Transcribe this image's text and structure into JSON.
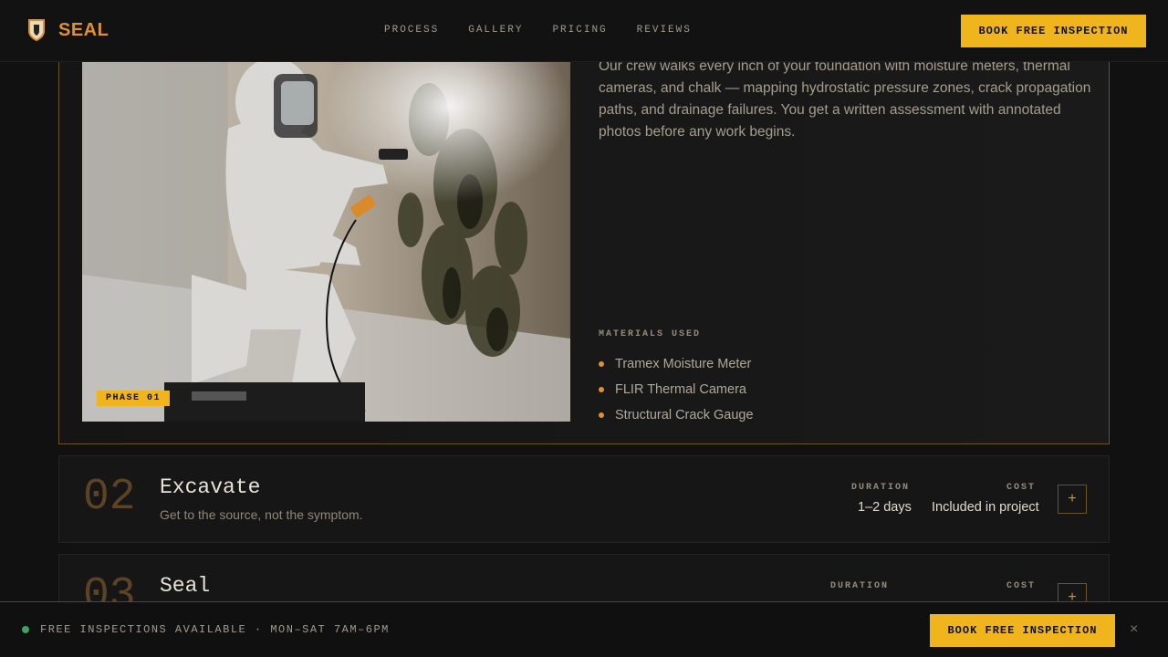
{
  "brand": {
    "name": "SEAL"
  },
  "nav": {
    "items": [
      "PROCESS",
      "GALLERY",
      "PRICING",
      "REVIEWS"
    ]
  },
  "header": {
    "cta_label": "BOOK FREE INSPECTION"
  },
  "phase1": {
    "badge": "PHASE 01",
    "description": "Our crew walks every inch of your foundation with moisture meters, thermal cameras, and chalk — mapping hydrostatic pressure zones, crack propagation paths, and drainage failures. You get a written assessment with annotated photos before any work begins.",
    "materials_title": "MATERIALS USED",
    "materials": [
      "Tramex Moisture Meter",
      "FLIR Thermal Camera",
      "Structural Crack Gauge"
    ]
  },
  "phases": [
    {
      "number": "02",
      "title": "Excavate",
      "subtitle": "Get to the source, not the symptom.",
      "duration_label": "DURATION",
      "duration": "1–2 days",
      "cost_label": "COST",
      "cost": "Included in project"
    },
    {
      "number": "03",
      "title": "Seal",
      "subtitle": "",
      "duration_label": "DURATION",
      "duration": "",
      "cost_label": "COST",
      "cost": ""
    }
  ],
  "bottom_bar": {
    "status": "FREE INSPECTIONS AVAILABLE · MON–SAT 7AM–6PM",
    "cta_label": "BOOK FREE INSPECTION",
    "close": "×"
  },
  "colors": {
    "accent": "#f0b41c",
    "brand": "#e0902e",
    "status_ok": "#3ba55c"
  }
}
